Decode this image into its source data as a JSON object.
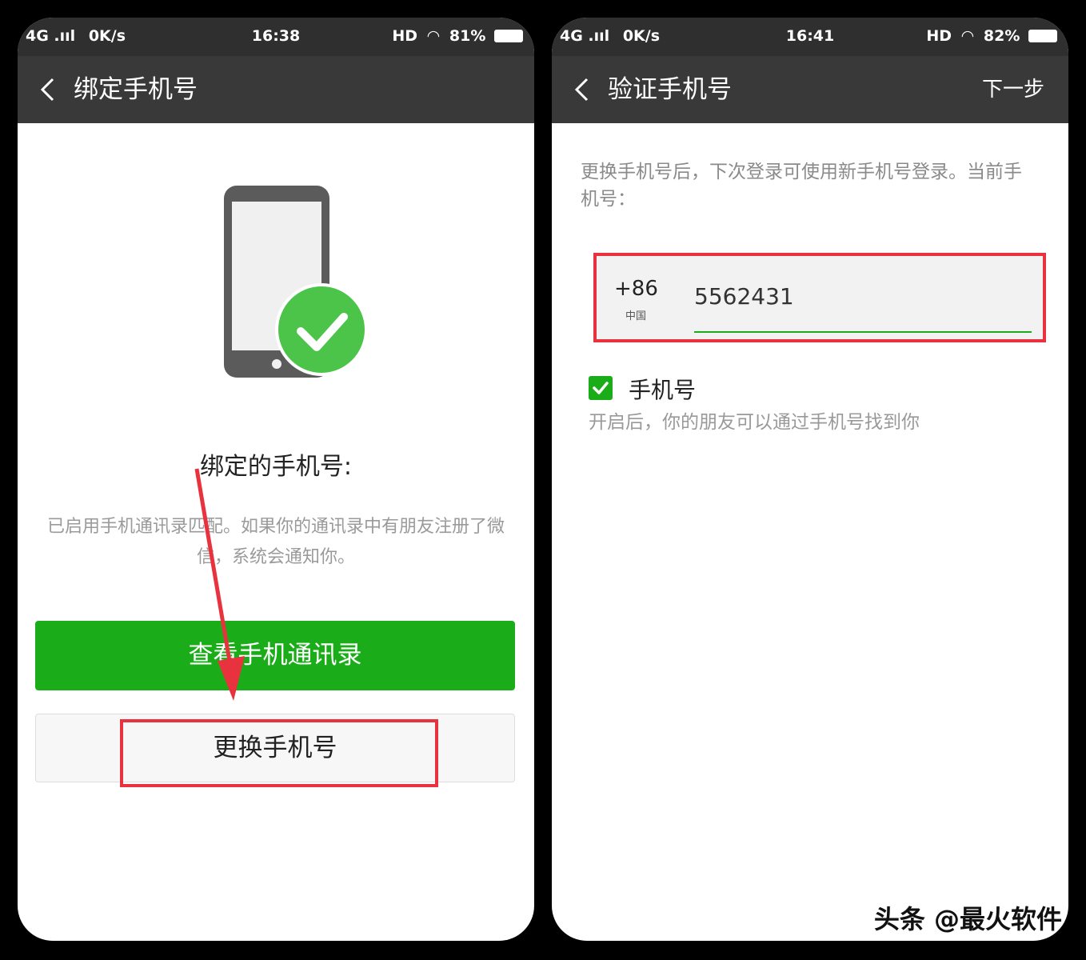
{
  "left_screen": {
    "status": {
      "signal": "4G .ııl",
      "speed": "0K/s",
      "time": "16:38",
      "right": "HD",
      "battery": "81%"
    },
    "nav": {
      "title": "绑定手机号"
    },
    "bound_label": "绑定的手机号:",
    "description": "已启用手机通讯录匹配。如果你的通讯录中有朋友注册了微信，系统会通知你。",
    "primary_button": "查看手机通讯录",
    "secondary_button": "更换手机号"
  },
  "right_screen": {
    "status": {
      "signal": "4G .ııl",
      "speed": "0K/s",
      "time": "16:41",
      "right": "HD",
      "battery": "82%"
    },
    "nav": {
      "title": "验证手机号",
      "action": "下一步"
    },
    "description": "更换手机号后，下次登录可使用新手机号登录。当前手机号：",
    "country_code": "+86",
    "country_name": "中国",
    "phone_value": "5562431",
    "checkbox_label": "手机号",
    "checkbox_checked": true,
    "checkbox_description": "开启后，你的朋友可以通过手机号找到你"
  },
  "watermark": "头条 @最火软件",
  "colors": {
    "green": "#1aad19",
    "dark_bar": "#393939",
    "annotation_red": "#e8333f"
  }
}
